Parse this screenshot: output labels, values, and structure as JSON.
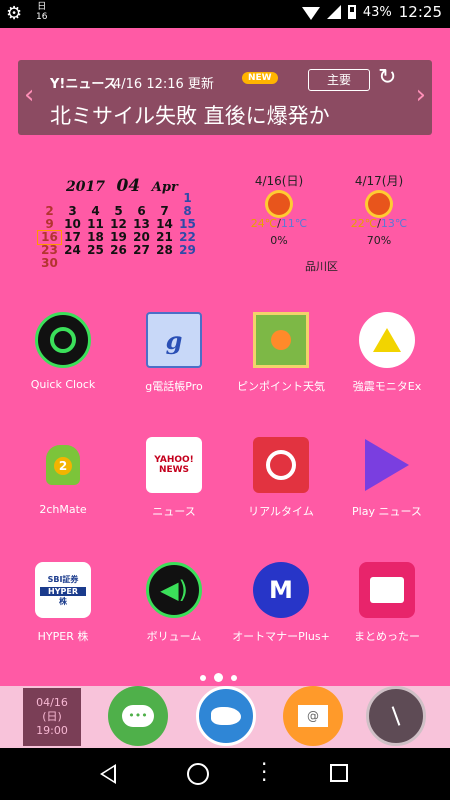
{
  "status_bar": {
    "calendar_icon_text": "日\n16",
    "battery": "43%",
    "time": "12:25"
  },
  "news_widget": {
    "logo": "Y!ニュース",
    "timestamp": "4/16 12:16 更新",
    "badge": "NEW",
    "tab": "主要",
    "headline": "北ミサイル失敗 直後に爆発か"
  },
  "calendar": {
    "year": "2017",
    "month": "04",
    "month_name": "Apr",
    "weeks": [
      [
        "",
        "",
        "",
        "",
        "",
        "",
        "1"
      ],
      [
        "2",
        "3",
        "4",
        "5",
        "6",
        "7",
        "8"
      ],
      [
        "9",
        "10",
        "11",
        "12",
        "13",
        "14",
        "15"
      ],
      [
        "16",
        "17",
        "18",
        "19",
        "20",
        "21",
        "22"
      ],
      [
        "23",
        "24",
        "25",
        "26",
        "27",
        "28",
        "29"
      ],
      [
        "30",
        "",
        "",
        "",
        "",
        "",
        ""
      ]
    ],
    "today": "16"
  },
  "weather": {
    "days": [
      {
        "date": "4/16(日)",
        "high": "24℃",
        "low": "11℃",
        "rain": "0%"
      },
      {
        "date": "4/17(月)",
        "high": "22℃",
        "low": "13℃",
        "rain": "70%"
      }
    ],
    "area": "品川区"
  },
  "apps": [
    {
      "label": "Quick Clock",
      "icon": "quick-clock-icon"
    },
    {
      "label": "g電話帳Pro",
      "icon": "g-phonebook-icon"
    },
    {
      "label": "ピンポイント天気",
      "icon": "pinpoint-weather-icon"
    },
    {
      "label": "強震モニタEx",
      "icon": "earthquake-monitor-icon"
    },
    {
      "label": "2chMate",
      "icon": "2chmate-icon"
    },
    {
      "label": "ニュース",
      "icon": "yahoo-news-icon"
    },
    {
      "label": "リアルタイム",
      "icon": "realtime-icon"
    },
    {
      "label": "Play ニュース",
      "icon": "play-news-icon"
    },
    {
      "label": "HYPER 株",
      "icon": "hyper-kabu-icon"
    },
    {
      "label": "ボリューム",
      "icon": "volume-icon"
    },
    {
      "label": "オートマナーPlus+",
      "icon": "automanner-icon"
    },
    {
      "label": "まとめったー",
      "icon": "matometter-icon"
    }
  ],
  "app_icon_text": {
    "g_phonebook": "g",
    "yahoo_top": "YAHOO!",
    "yahoo_bottom": "NEWS",
    "sbi_top": "SBI証券",
    "sbi_band": "HYPER",
    "sbi_bottom": "株",
    "volume": "◀)",
    "automanner": "M"
  },
  "dock": {
    "clock_widget": {
      "date": "04/16",
      "weekday": "(日)",
      "time": "19:00"
    }
  }
}
